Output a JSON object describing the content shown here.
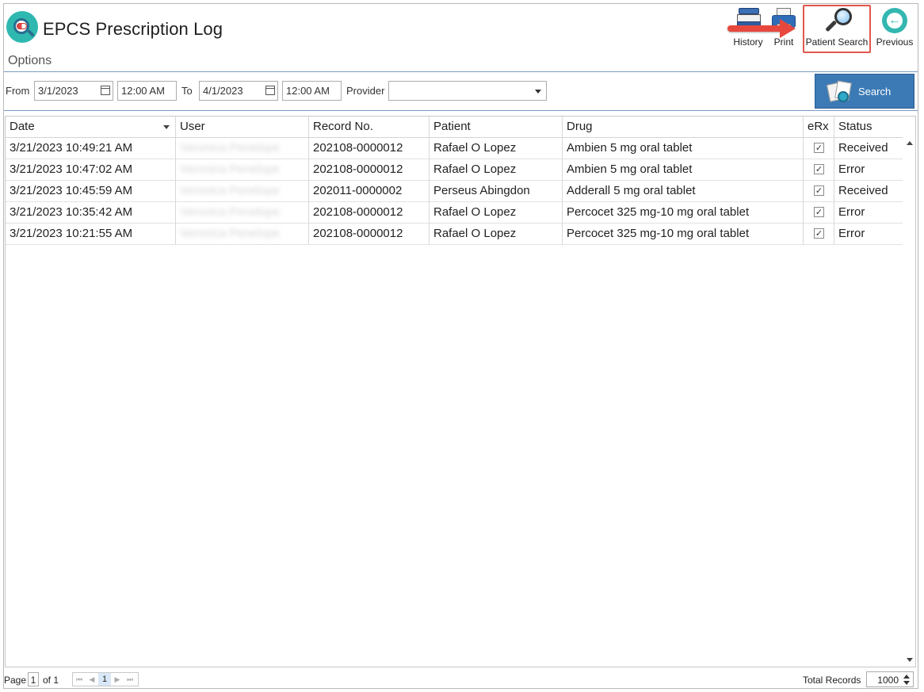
{
  "app": {
    "title": "EPCS Prescription Log",
    "options_label": "Options"
  },
  "toolbar": {
    "history_label": "History",
    "print_label": "Print",
    "patient_search_label": "Patient Search",
    "previous_label": "Previous"
  },
  "filter": {
    "from_label": "From",
    "from_date": "3/1/2023",
    "from_time": "12:00 AM",
    "to_label": "To",
    "to_date": "4/1/2023",
    "to_time": "12:00 AM",
    "provider_label": "Provider",
    "provider_value": "",
    "search_label": "Search"
  },
  "grid": {
    "columns": [
      "Date",
      "User",
      "Record No.",
      "Patient",
      "Drug",
      "eRx",
      "Status"
    ],
    "rows": [
      {
        "date": "3/21/2023 10:49:21 AM",
        "user": "Veronica Penelope",
        "record": "202108-0000012",
        "patient": "Rafael O Lopez",
        "drug": "Ambien 5 mg oral tablet",
        "erx": "✓",
        "status": "Received"
      },
      {
        "date": "3/21/2023 10:47:02 AM",
        "user": "Veronica Penelope",
        "record": "202108-0000012",
        "patient": "Rafael O Lopez",
        "drug": "Ambien 5 mg oral tablet",
        "erx": "✓",
        "status": "Error"
      },
      {
        "date": "3/21/2023 10:45:59 AM",
        "user": "Veronica Penelope",
        "record": "202011-0000002",
        "patient": "Perseus Abingdon",
        "drug": "Adderall 5 mg oral tablet",
        "erx": "✓",
        "status": "Received"
      },
      {
        "date": "3/21/2023 10:35:42 AM",
        "user": "Veronica Penelope",
        "record": "202108-0000012",
        "patient": "Rafael O Lopez",
        "drug": "Percocet 325 mg-10 mg oral tablet",
        "erx": "✓",
        "status": "Error"
      },
      {
        "date": "3/21/2023 10:21:55 AM",
        "user": "Veronica Penelope",
        "record": "202108-0000012",
        "patient": "Rafael O Lopez",
        "drug": "Percocet 325 mg-10 mg oral tablet",
        "erx": "✓",
        "status": "Error"
      }
    ]
  },
  "footer": {
    "page_label": "Page",
    "page_value": "1",
    "of_label": "of 1",
    "pager_current": "1",
    "total_label": "Total Records",
    "total_value": "1000"
  },
  "colors": {
    "accent": "#3c7ab5",
    "brand": "#33b7b0",
    "highlight": "#e8473d"
  }
}
